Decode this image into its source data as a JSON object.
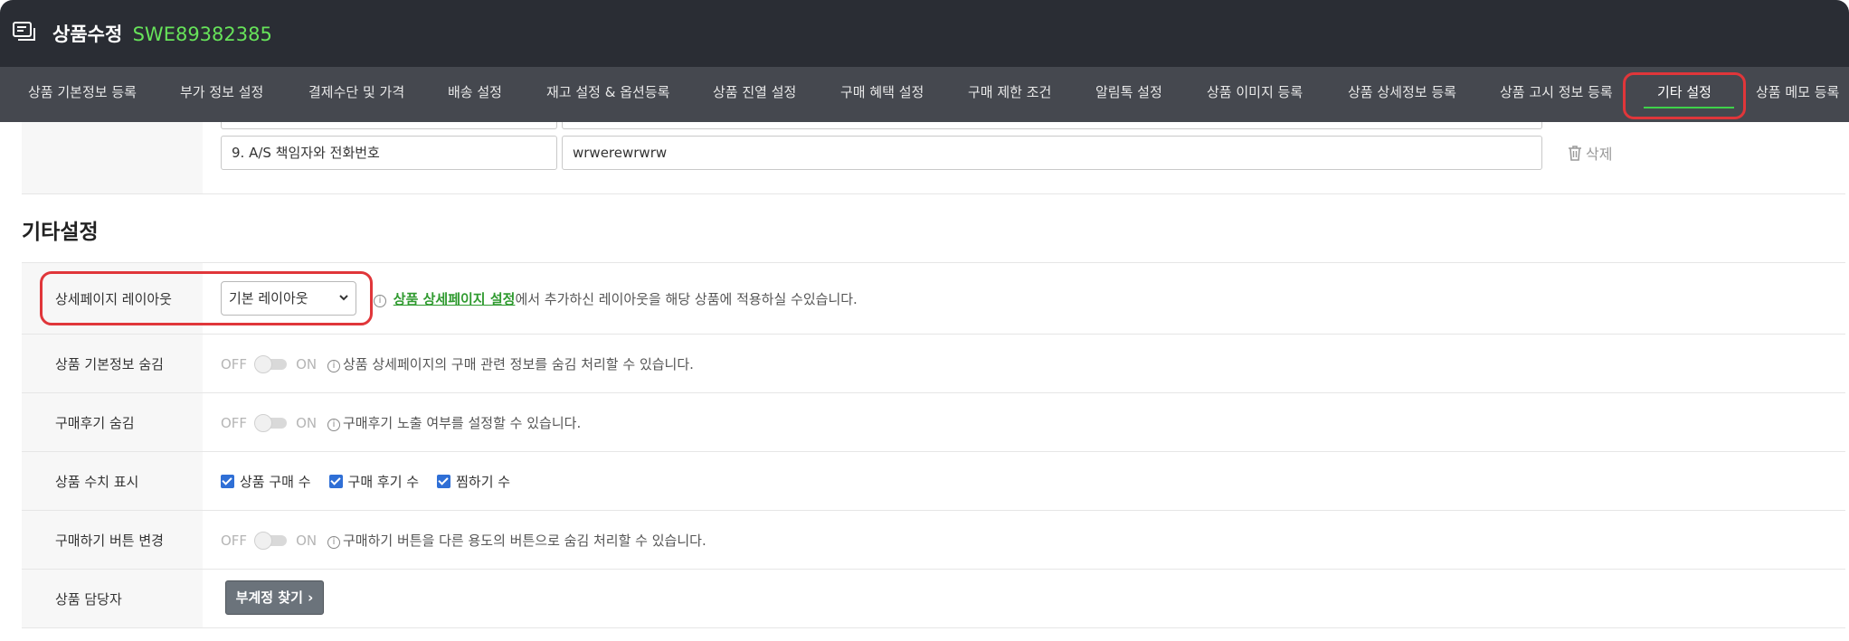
{
  "header": {
    "title": "상품수정",
    "product_code": "SWE89382385"
  },
  "tabs": [
    {
      "label": "상품 기본정보 등록"
    },
    {
      "label": "부가 정보 설정"
    },
    {
      "label": "결제수단 및 가격"
    },
    {
      "label": "배송 설정"
    },
    {
      "label": "재고 설정 & 옵션등록"
    },
    {
      "label": "상품 진열 설정"
    },
    {
      "label": "구매 혜택 설정"
    },
    {
      "label": "구매 제한 조건"
    },
    {
      "label": "알림톡 설정"
    },
    {
      "label": "상품 이미지 등록"
    },
    {
      "label": "상품 상세정보 등록"
    },
    {
      "label": "상품 고시 정보 등록"
    },
    {
      "label": "기타 설정",
      "active": true
    },
    {
      "label": "상품 메모 등록"
    }
  ],
  "notice_row": {
    "name_value": "9. A/S 책임자와 전화번호",
    "content_value": "wrwerewrwrw",
    "delete_label": "삭제"
  },
  "section": {
    "title": "기타설정"
  },
  "rows": {
    "layout": {
      "label": "상세페이지 레이아웃",
      "selected": "기본 레이아웃",
      "info_link": "상품 상세페이지 설정",
      "info_rest": "에서 추가하신 레이아웃을 해당 상품에 적용하실 수있습니다."
    },
    "hide_basic": {
      "label": "상품 기본정보 숨김",
      "off": "OFF",
      "on": "ON",
      "info": "상품 상세페이지의 구매 관련 정보를 숨김 처리할 수 있습니다."
    },
    "hide_review": {
      "label": "구매후기 숨김",
      "off": "OFF",
      "on": "ON",
      "info": "구매후기 노출 여부를 설정할 수 있습니다."
    },
    "stats": {
      "label": "상품 수치 표시",
      "options": [
        "상품 구매 수",
        "구매 후기 수",
        "찜하기 수"
      ]
    },
    "buy_button": {
      "label": "구매하기 버튼 변경",
      "off": "OFF",
      "on": "ON",
      "info": "구매하기 버튼을 다른 용도의 버튼으로 숨김 처리할 수 있습니다."
    },
    "manager": {
      "label": "상품 담당자",
      "button": "부계정 찾기 ›"
    }
  },
  "info_glyph": "i",
  "colors": {
    "topbar": "#2a2d34",
    "tabbar": "#45484f",
    "code_green": "#67e35a",
    "active_underline": "#3fd24a",
    "highlight_red": "#e0363a",
    "link_green": "#2f9a2f",
    "checkbox_blue": "#2f6fd6"
  }
}
